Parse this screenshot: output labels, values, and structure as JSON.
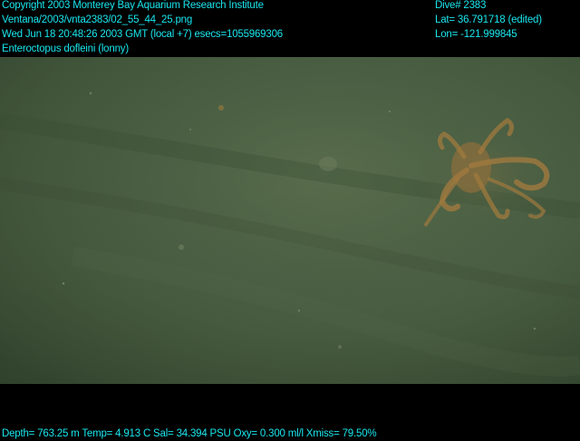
{
  "overlay": {
    "copyright": "Copyright 2003 Monterey Bay Aquarium Research Institute",
    "file_path": "Ventana/2003/vnta2383/02_55_44_25.png",
    "datetime": "Wed Jun 18 20:48:26 2003 GMT (local +7)  esecs=1055969306",
    "species": "Enteroctopus dofleini (lonny)",
    "dive": "Dive# 2383",
    "latitude": "Lat= 36.791718 (edited)",
    "longitude": "Lon= -121.999845",
    "sensors": "Depth= 763.25 m  Temp= 4.913 C  Sal= 34.394 PSU  Oxy= 0.300 ml/l  Xmiss= 79.50%"
  },
  "colors": {
    "overlay_text": "#19e6ee",
    "letterbox": "#000000",
    "seafloor": "#4a5f43",
    "octopus": "#a0793e"
  },
  "scene": {
    "subject": "octopus-on-seafloor"
  }
}
